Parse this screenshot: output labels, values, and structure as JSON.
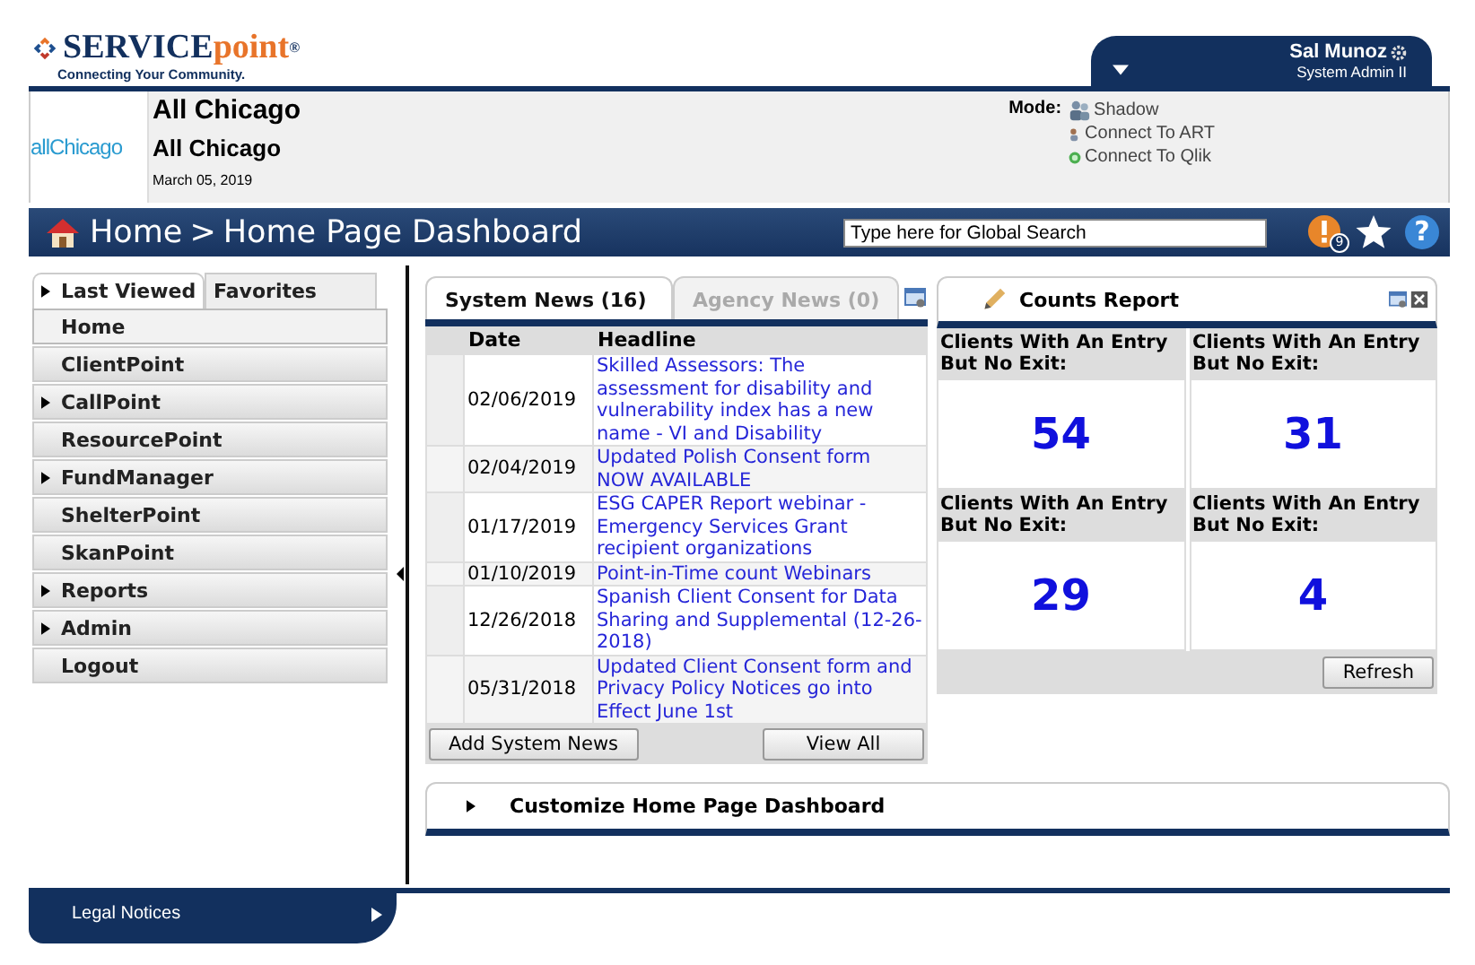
{
  "header": {
    "logo": {
      "word_1": "SERVICE",
      "word_2": "point",
      "mark": "®",
      "tagline": "Connecting Your Community."
    },
    "user": {
      "name": "Sal Munoz",
      "role": "System Admin II"
    }
  },
  "org": {
    "logo_text": "allChicago",
    "title": "All Chicago",
    "subtitle": "All Chicago",
    "date": "March 05, 2019"
  },
  "mode": {
    "label": "Mode:",
    "options": [
      {
        "kind": "shadow",
        "label": "Shadow"
      },
      {
        "kind": "art",
        "label": "Connect To ART"
      },
      {
        "kind": "qlik",
        "label": "Connect To Qlik"
      }
    ]
  },
  "breadcrumb": {
    "home": "Home",
    "separator": ">",
    "page": "Home Page Dashboard"
  },
  "search": {
    "placeholder": "Type here for Global Search"
  },
  "toolbar": {
    "alert_count": "9",
    "help": "?"
  },
  "nav": {
    "tabs": [
      {
        "label": "Last Viewed",
        "selected": true,
        "expandable": true
      },
      {
        "label": "Favorites",
        "selected": false,
        "expandable": false
      }
    ],
    "items": [
      {
        "label": "Home",
        "expandable": false,
        "selected": true
      },
      {
        "label": "ClientPoint",
        "expandable": false,
        "selected": false
      },
      {
        "label": "CallPoint",
        "expandable": true,
        "selected": false
      },
      {
        "label": "ResourcePoint",
        "expandable": false,
        "selected": false
      },
      {
        "label": "FundManager",
        "expandable": true,
        "selected": false
      },
      {
        "label": "ShelterPoint",
        "expandable": false,
        "selected": false
      },
      {
        "label": "SkanPoint",
        "expandable": false,
        "selected": false
      },
      {
        "label": "Reports",
        "expandable": true,
        "selected": false
      },
      {
        "label": "Admin",
        "expandable": true,
        "selected": false
      },
      {
        "label": "Logout",
        "expandable": false,
        "selected": false
      }
    ]
  },
  "news": {
    "tabs": [
      {
        "label": "System News (16)",
        "selected": true
      },
      {
        "label": "Agency News (0)",
        "selected": false
      }
    ],
    "columns": [
      "Date",
      "Headline"
    ],
    "rows": [
      {
        "date": "02/06/2019",
        "headline": "Skilled Assessors: The assessment for disability and vulnerability index has a new name - VI and Disability"
      },
      {
        "date": "02/04/2019",
        "headline": "Updated Polish Consent form NOW AVAILABLE"
      },
      {
        "date": "01/17/2019",
        "headline": "ESG CAPER Report webinar - Emergency Services Grant recipient organizations"
      },
      {
        "date": "01/10/2019",
        "headline": "Point-in-Time count Webinars"
      },
      {
        "date": "12/26/2018",
        "headline": "Spanish Client Consent for Data Sharing and Supplemental (12-26-2018)"
      },
      {
        "date": "05/31/2018",
        "headline": "Updated Client Consent form and Privacy Policy Notices go into Effect June 1st"
      }
    ],
    "buttons": [
      "Add System News",
      "View All"
    ]
  },
  "counts": {
    "title": "Counts Report",
    "cells": [
      {
        "label": "Clients With An Entry But No Exit:",
        "value": "54"
      },
      {
        "label": "Clients With An Entry But No Exit:",
        "value": "31"
      },
      {
        "label": "Clients With An Entry But No Exit:",
        "value": "29"
      },
      {
        "label": "Clients With An Entry But No Exit:",
        "value": "4"
      }
    ],
    "refresh": "Refresh"
  },
  "customize": {
    "label": "Customize Home Page Dashboard",
    "expanded": false
  },
  "footer": {
    "legal": "Legal Notices"
  }
}
